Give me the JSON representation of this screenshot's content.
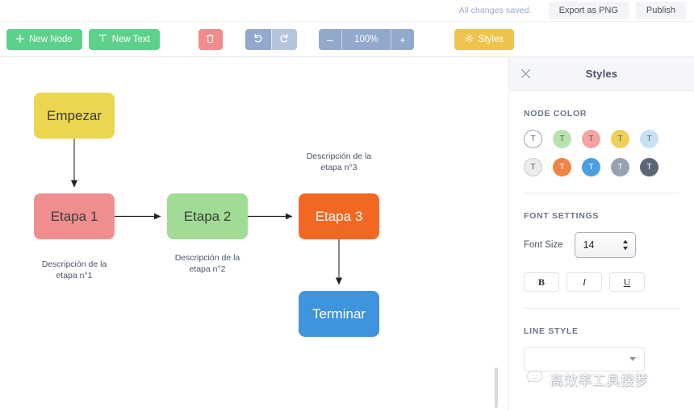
{
  "topbar": {
    "saved_text": "All changes saved.",
    "export_label": "Export as PNG",
    "publish_label": "Publish"
  },
  "toolbar": {
    "new_node_label": "New Node",
    "new_node_icon": "plus-icon",
    "new_text_label": "New Text",
    "new_text_icon": "text-t-icon",
    "delete_icon": "trash-icon",
    "undo_icon": "undo-arrow-icon",
    "redo_icon": "redo-arrow-icon",
    "zoom_out_label": "–",
    "zoom_level": "100%",
    "zoom_in_label": "+",
    "styles_label": "Styles",
    "styles_icon": "gear-icon"
  },
  "canvas": {
    "nodes": [
      {
        "id": "empezar",
        "label": "Empezar",
        "color": "#edd64f",
        "text_color": "#3c3c3c"
      },
      {
        "id": "etapa1",
        "label": "Etapa 1",
        "color": "#ef8e8e",
        "text_color": "#3c3c3c"
      },
      {
        "id": "etapa2",
        "label": "Etapa 2",
        "color": "#a0dc96",
        "text_color": "#3c3c3c"
      },
      {
        "id": "etapa3",
        "label": "Etapa 3",
        "color": "#f26722",
        "text_color": "#ffffff"
      },
      {
        "id": "terminar",
        "label": "Terminar",
        "color": "#3f94dd",
        "text_color": "#ffffff"
      }
    ],
    "descriptions": [
      {
        "id": "desc1",
        "line1": "Descripción de la",
        "line2": "etapa n°1"
      },
      {
        "id": "desc2",
        "line1": "Descripción de la",
        "line2": "etapa n°2"
      },
      {
        "id": "desc3",
        "line1": "Descripción de la",
        "line2": "etapa n°3"
      }
    ]
  },
  "panel": {
    "title": "Styles",
    "close_icon": "close-x-icon",
    "node_color_label": "NODE COLOR",
    "swatch_letter": "T",
    "swatches_row1": [
      "#ffffff",
      "#b8e3ae",
      "#f4a3a3",
      "#edd05a",
      "#c5e1f2"
    ],
    "swatches_row2": [
      "#ececec",
      "#f08444",
      "#4b9ee0",
      "#97a0ae",
      "#5a6676"
    ],
    "font_settings_label": "FONT SETTINGS",
    "font_size_label": "Font Size",
    "font_size_value": "14",
    "bold_label": "B",
    "italic_label": "I",
    "underline_label": "U",
    "line_style_label": "LINE STYLE",
    "line_style_value": ""
  },
  "watermark": {
    "text": "高效率工具搜罗",
    "icon": "chat-bubble-smiley-icon"
  }
}
